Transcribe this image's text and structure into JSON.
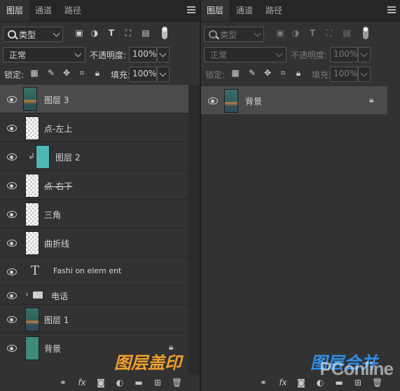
{
  "colors": {
    "panel_bg": "#323232",
    "tabbar_bg": "#262626",
    "selected_row": "#4b4b4b",
    "caption_left": "#f0a02a",
    "caption_right": "#2f8fe8"
  },
  "left": {
    "tabs": [
      "图层",
      "通道",
      "路径"
    ],
    "filter": {
      "label": "类型"
    },
    "blend_mode": "正常",
    "opacity_label": "不透明度:",
    "opacity_value": "100%",
    "lock_label": "锁定:",
    "fill_label": "填充:",
    "fill_value": "100%",
    "layers": [
      {
        "name": "图层 3",
        "selected": true,
        "thumb": "poster"
      },
      {
        "name": "点-左上",
        "thumb": "transparent"
      },
      {
        "name": "图层 2",
        "thumb": "cyan",
        "clipped": true
      },
      {
        "name": "点-右下",
        "thumb": "transparent",
        "strikethrough": true
      },
      {
        "name": "三角",
        "thumb": "transparent"
      },
      {
        "name": "曲折线",
        "thumb": "transparent"
      },
      {
        "name": "Fashi on  elem ent",
        "thumb": "text-T",
        "icon_text": "T"
      },
      {
        "name": "电话",
        "thumb": "folder"
      },
      {
        "name": "图层 1",
        "thumb": "poster-small"
      },
      {
        "name": "背景",
        "thumb": "teal",
        "locked": true
      }
    ],
    "caption": "图层盖印"
  },
  "right": {
    "tabs": [
      "图层",
      "通道",
      "路径"
    ],
    "filter": {
      "label": "类型"
    },
    "blend_mode": "正常",
    "opacity_label": "不透明度:",
    "opacity_value": "100%",
    "lock_label": "锁定:",
    "fill_label": "填充:",
    "fill_value": "100%",
    "layers": [
      {
        "name": "背景",
        "selected": true,
        "thumb": "poster",
        "locked": true
      }
    ],
    "caption": "图层合并",
    "watermark": "PConline"
  },
  "icons": {
    "filter": [
      "image-filter-icon",
      "adjustment-filter-icon",
      "type-filter-icon",
      "shape-filter-icon",
      "smart-object-filter-icon"
    ],
    "lock": [
      "lock-transparent-icon",
      "lock-paint-icon",
      "lock-position-icon",
      "lock-artboard-icon",
      "lock-all-icon"
    ],
    "bottom": [
      "link-icon",
      "fx-icon",
      "mask-icon",
      "adjustment-icon",
      "group-icon",
      "new-layer-icon",
      "delete-icon"
    ]
  }
}
